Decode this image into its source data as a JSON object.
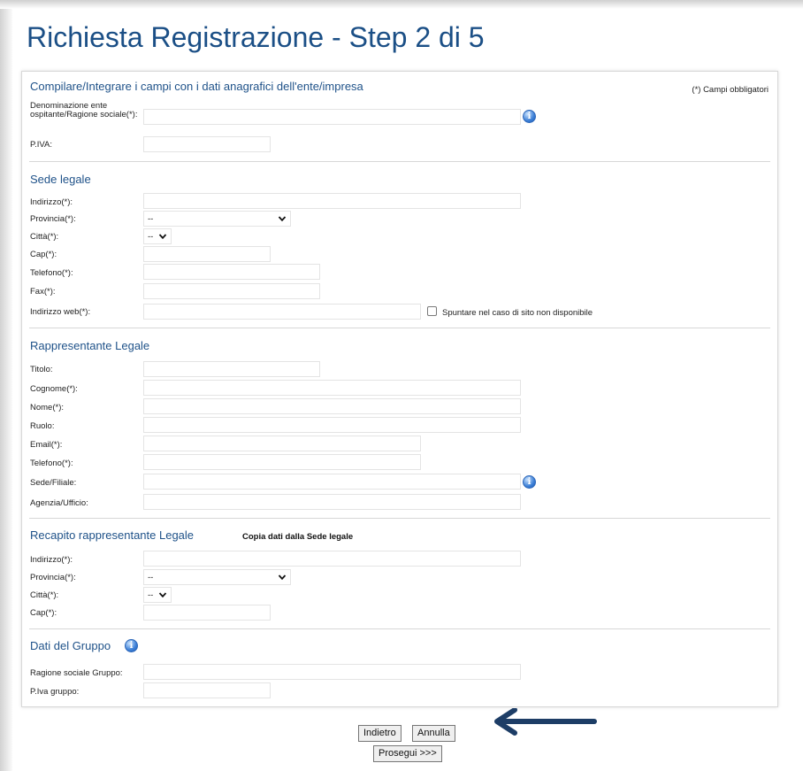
{
  "page": {
    "title": "Richiesta Registrazione - Step 2 di 5"
  },
  "anagrafica": {
    "title": "Compilare/Integrare i campi con i dati anagrafici dell'ente/impresa",
    "required_note": "(*) Campi obbligatori",
    "denominazione_label": "Denominazione ente ospitante/Ragione sociale(*):",
    "piva_label": "P.IVA:"
  },
  "sede_legale": {
    "title": "Sede legale",
    "indirizzo_label": "Indirizzo(*):",
    "provincia_label": "Provincia(*):",
    "provincia_value": "--",
    "citta_label": "Città(*):",
    "citta_value": "--",
    "cap_label": "Cap(*):",
    "telefono_label": "Telefono(*):",
    "fax_label": "Fax(*):",
    "web_label": "Indirizzo web(*):",
    "web_checkbox_label": "Spuntare nel caso di sito non disponibile"
  },
  "rappresentante": {
    "title": "Rappresentante Legale",
    "titolo_label": "Titolo:",
    "cognome_label": "Cognome(*):",
    "nome_label": "Nome(*):",
    "ruolo_label": "Ruolo:",
    "email_label": "Email(*):",
    "telefono_label": "Telefono(*):",
    "sede_label": "Sede/Filiale:",
    "agenzia_label": "Agenzia/Ufficio:"
  },
  "recapito": {
    "title": "Recapito rappresentante Legale",
    "copy_link": "Copia dati dalla Sede legale",
    "indirizzo_label": "Indirizzo(*):",
    "provincia_label": "Provincia(*):",
    "provincia_value": "--",
    "citta_label": "Città(*):",
    "citta_value": "--",
    "cap_label": "Cap(*):"
  },
  "gruppo": {
    "title": "Dati del Gruppo",
    "ragione_label": "Ragione sociale Gruppo:",
    "piva_label": "P.Iva gruppo:"
  },
  "buttons": {
    "back": "Indietro",
    "cancel": "Annulla",
    "next": "Prosegui >>>"
  },
  "icons": {
    "info": "info-icon",
    "chevron": "chevron-down-icon",
    "arrow": "arrow-left-icon"
  },
  "colors": {
    "title": "#1b4f86",
    "section_title": "#1f5289",
    "arrow": "#1d3d66"
  }
}
